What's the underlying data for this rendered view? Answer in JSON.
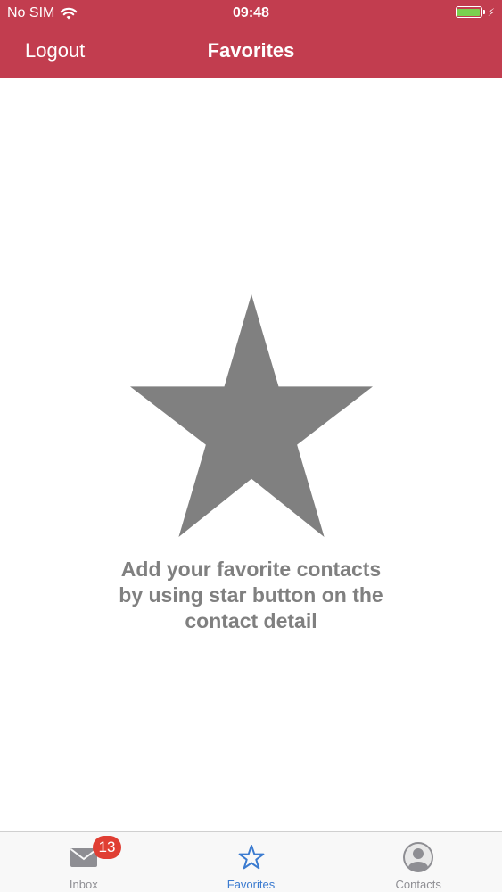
{
  "status_bar": {
    "carrier": "No SIM",
    "time": "09:48",
    "battery_color": "#7ad14f"
  },
  "nav_bar": {
    "left_button": "Logout",
    "title": "Favorites",
    "background": "#c23d4f"
  },
  "empty_state": {
    "icon": "star-icon",
    "message": "Add your favorite contacts by using star button on the contact detail"
  },
  "tab_bar": {
    "tabs": [
      {
        "label": "Inbox",
        "icon": "envelope-icon",
        "badge": "13",
        "active": false
      },
      {
        "label": "Favorites",
        "icon": "star-outline-icon",
        "active": true
      },
      {
        "label": "Contacts",
        "icon": "person-icon",
        "active": false
      }
    ],
    "active_color": "#3b7bd0",
    "badge_color": "#e03e33"
  }
}
